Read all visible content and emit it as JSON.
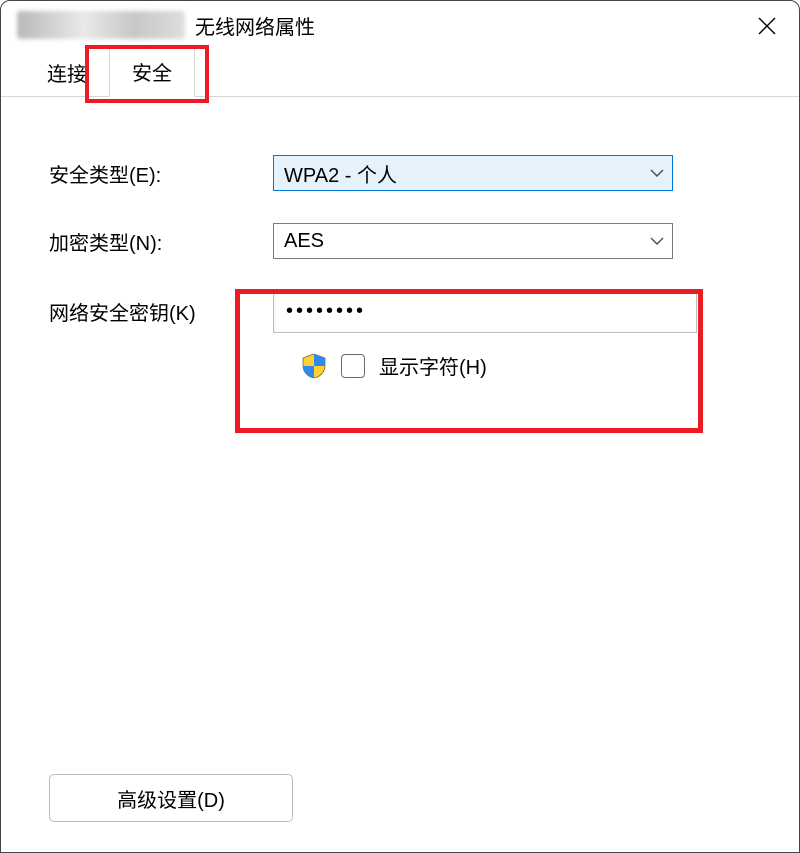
{
  "window": {
    "title_suffix": "无线网络属性"
  },
  "tabs": {
    "connection": "连接",
    "security": "安全"
  },
  "form": {
    "security_type_label": "安全类型(E):",
    "security_type_value": "WPA2 - 个人",
    "encryption_type_label": "加密类型(N):",
    "encryption_type_value": "AES",
    "key_label": "网络安全密钥(K)",
    "key_value": "••••••••",
    "show_chars_label": "显示字符(H)"
  },
  "buttons": {
    "advanced": "高级设置(D)"
  }
}
